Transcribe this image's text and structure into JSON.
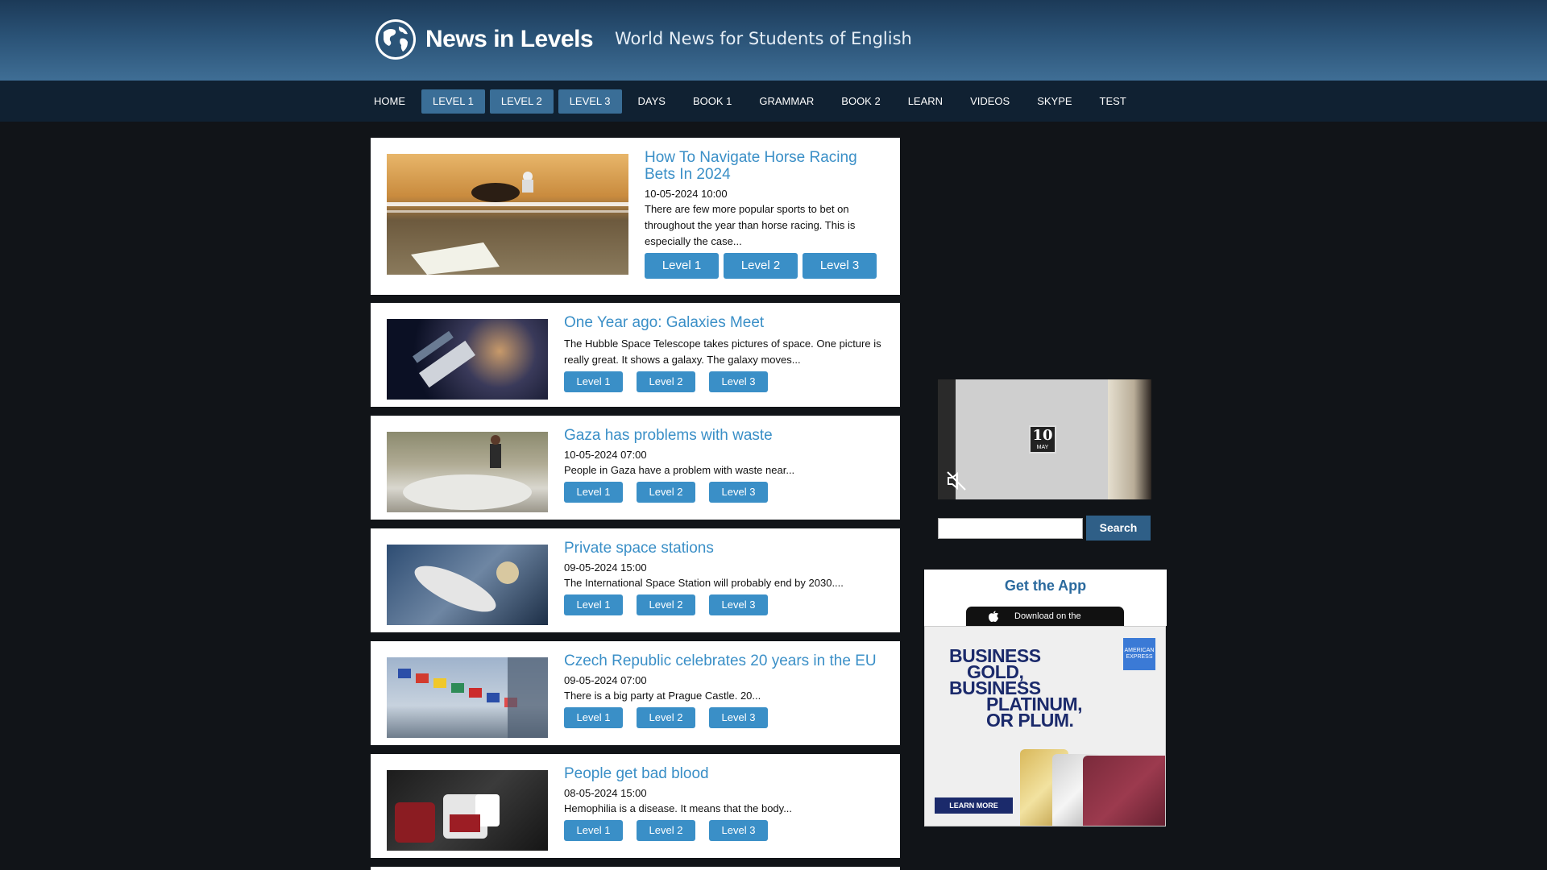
{
  "header": {
    "site_name": "News in Levels",
    "tagline": "World News for Students of English"
  },
  "nav": {
    "items": [
      "HOME",
      "LEVEL 1",
      "LEVEL 2",
      "LEVEL 3",
      "DAYS",
      "BOOK 1",
      "GRAMMAR",
      "BOOK 2",
      "LEARN",
      "VIDEOS",
      "SKYPE",
      "TEST"
    ],
    "active_items": [
      "LEVEL 1",
      "LEVEL 2",
      "LEVEL 3"
    ]
  },
  "articles": [
    {
      "title": "How To Navigate Horse Racing Bets In 2024",
      "date": "10-05-2024 10:00",
      "description": "There are few more popular sports to bet on throughout the year than horse racing. This is especially the case...",
      "levels": [
        "Level 1",
        "Level 2",
        "Level 3"
      ]
    },
    {
      "title": "One Year ago: Galaxies Meet",
      "date": "",
      "description": "The Hubble Space Telescope takes pictures of space. One picture is really great. It shows a galaxy. The galaxy moves...",
      "levels": [
        "Level 1",
        "Level 2",
        "Level 3"
      ]
    },
    {
      "title": "Gaza has problems with waste",
      "date": "10-05-2024 07:00",
      "description": "People in Gaza have a problem with waste near...",
      "levels": [
        "Level 1",
        "Level 2",
        "Level 3"
      ]
    },
    {
      "title": "Private space stations",
      "date": "09-05-2024 15:00",
      "description": "The International Space Station will probably end by 2030....",
      "levels": [
        "Level 1",
        "Level 2",
        "Level 3"
      ]
    },
    {
      "title": "Czech Republic celebrates 20 years in the EU",
      "date": "09-05-2024 07:00",
      "description": "There is a big party at Prague Castle. 20...",
      "levels": [
        "Level 1",
        "Level 2",
        "Level 3"
      ]
    },
    {
      "title": "People get bad blood",
      "date": "08-05-2024 15:00",
      "description": "Hemophilia is a disease. It means that the body...",
      "levels": [
        "Level 1",
        "Level 2",
        "Level 3"
      ]
    }
  ],
  "video": {
    "calendar_day": "10",
    "calendar_month": "MAY",
    "icon": "mute-icon"
  },
  "search": {
    "input_value": "",
    "button_label": "Search"
  },
  "app_promo": {
    "title": "Get the App",
    "badge_text": "Download on the"
  },
  "ad": {
    "lines": [
      "BUSINESS",
      "GOLD,",
      "BUSINESS",
      "PLATINUM,",
      "OR PLUM."
    ],
    "cta": "LEARN MORE",
    "logo_text": "AMERICAN EXPRESS"
  },
  "colors": {
    "accent": "#3a8fc7",
    "nav_bg": "#102132",
    "page_bg": "#111418",
    "ad_text": "#1b2a6b"
  }
}
